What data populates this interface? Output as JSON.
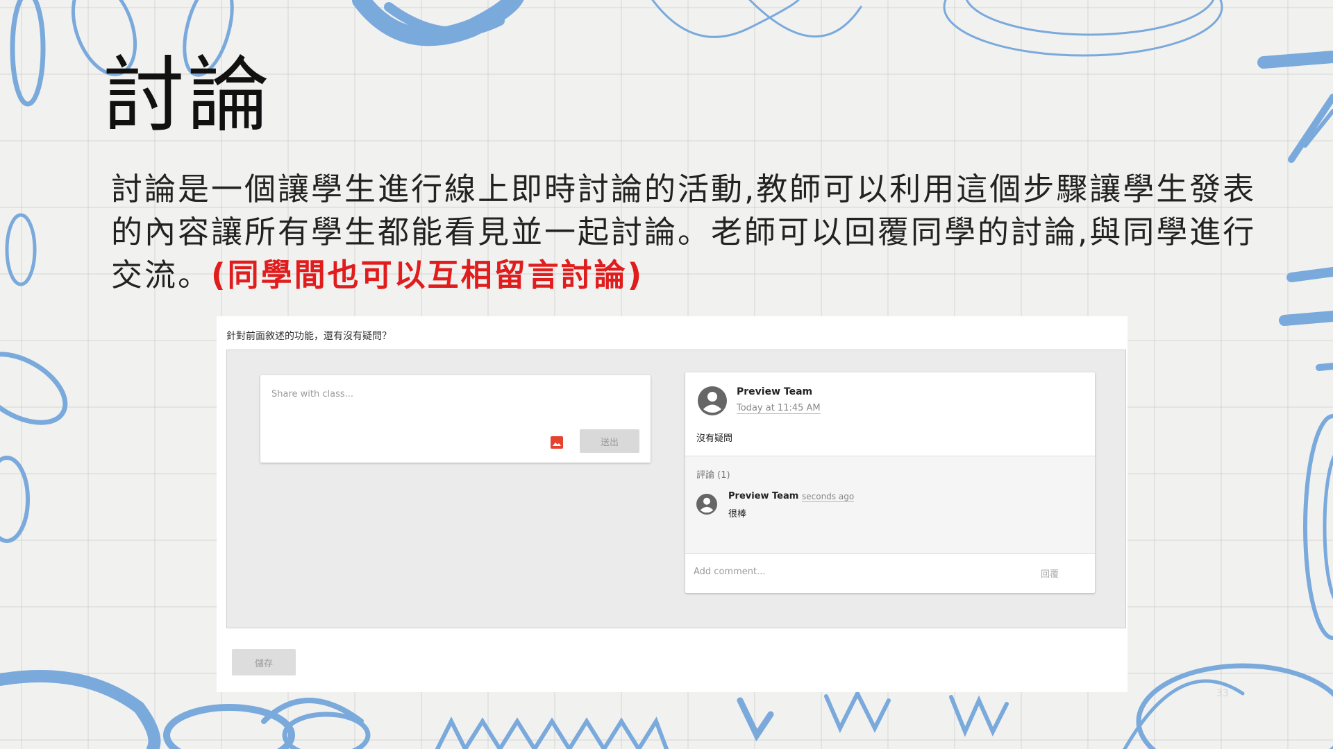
{
  "slide": {
    "title": "討論",
    "body": "討論是一個讓學生進行線上即時討論的活動,教師可以利用這個步驟讓學生發表的內容讓所有學生都能看見並一起討論。老師可以回覆同學的討論,與同學進行交流。",
    "highlight": "(同學間也可以互相留言討論)",
    "highlight_color": "#e01c1c",
    "accent_color": "#7aa9dc",
    "page_number": "33"
  },
  "screenshot": {
    "question": "針對前面敘述的功能，還有沒有疑問？",
    "share": {
      "placeholder": "Share with class...",
      "image_icon": "image-icon",
      "submit_label": "送出"
    },
    "post": {
      "avatar_icon": "account-circle-icon",
      "author": "Preview Team",
      "time": "Today at 11:45 AM",
      "text": "沒有疑問",
      "comments_header": "評論 (1)",
      "comment": {
        "author": "Preview Team",
        "time": "seconds ago",
        "text": "很棒"
      },
      "add_comment_placeholder": "Add comment...",
      "reply_label": "回覆"
    },
    "save_label": "儲存"
  }
}
